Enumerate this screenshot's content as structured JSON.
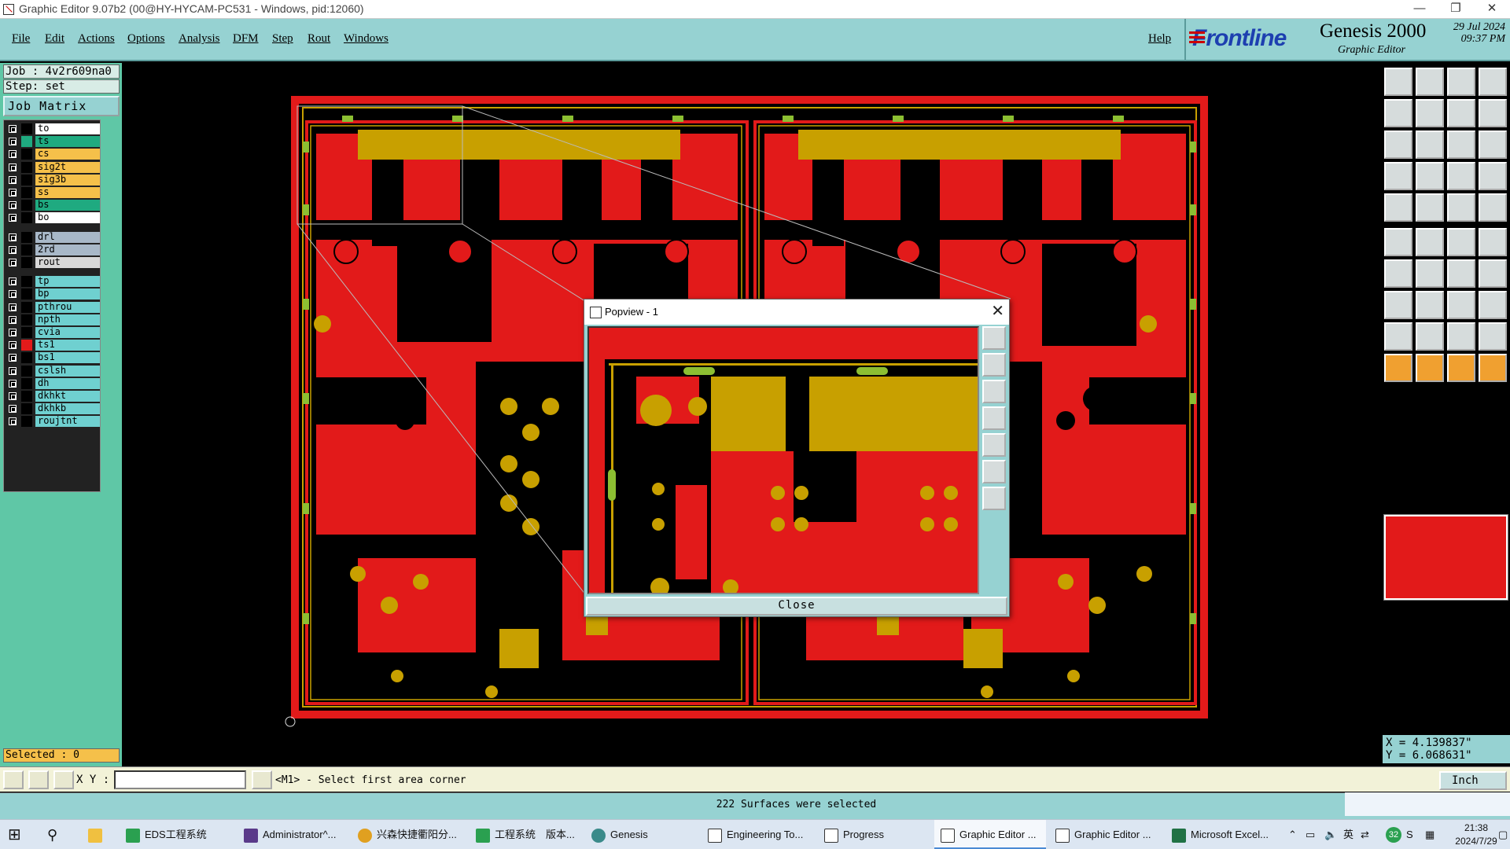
{
  "window": {
    "title": "Graphic Editor 9.07b2 (00@HY-HYCAM-PC531 - Windows, pid:12060)"
  },
  "menu": {
    "items": [
      "File",
      "Edit",
      "Actions",
      "Options",
      "Analysis",
      "DFM",
      "Step",
      "Rout",
      "Windows"
    ],
    "help": "Help"
  },
  "brand": {
    "logo": "Frontline",
    "product": "Genesis 2000",
    "subtitle": "Graphic Editor",
    "date": "29 Jul 2024",
    "time": "09:37 PM"
  },
  "job": {
    "job_label": "Job : 4v2r609na0",
    "step_label": "Step: set",
    "matrix_button": "Job Matrix ..."
  },
  "layers": [
    {
      "name": "to",
      "color": "#ffffff",
      "swatch": "#000000"
    },
    {
      "name": "ts",
      "color": "#1faa80",
      "swatch": "#1faa80"
    },
    {
      "name": "cs",
      "color": "#f5c04a",
      "swatch": "#000000"
    },
    {
      "name": "sig2t",
      "color": "#f5c04a",
      "swatch": "#000000"
    },
    {
      "name": "sig3b",
      "color": "#f5c04a",
      "swatch": "#000000"
    },
    {
      "name": "ss",
      "color": "#f5c04a",
      "swatch": "#000000"
    },
    {
      "name": "bs",
      "color": "#1faa80",
      "swatch": "#000000"
    },
    {
      "name": "bo",
      "color": "#ffffff",
      "swatch": "#000000"
    },
    {
      "name": "drl",
      "color": "#a8b8c8",
      "swatch": "#000000"
    },
    {
      "name": "2rd",
      "color": "#a8b8c8",
      "swatch": "#000000"
    },
    {
      "name": "rout",
      "color": "#d8d8d8",
      "swatch": "#000000"
    },
    {
      "name": "tp",
      "color": "#6fd0d0",
      "swatch": "#000000"
    },
    {
      "name": "bp",
      "color": "#6fd0d0",
      "swatch": "#000000"
    },
    {
      "name": "pthrou",
      "color": "#6fd0d0",
      "swatch": "#000000"
    },
    {
      "name": "npth",
      "color": "#6fd0d0",
      "swatch": "#000000"
    },
    {
      "name": "cvia",
      "color": "#6fd0d0",
      "swatch": "#000000"
    },
    {
      "name": "ts1",
      "color": "#6fd0d0",
      "swatch": "#e21a1a"
    },
    {
      "name": "bs1",
      "color": "#6fd0d0",
      "swatch": "#000000"
    },
    {
      "name": "cslsh",
      "color": "#6fd0d0",
      "swatch": "#000000"
    },
    {
      "name": "dh",
      "color": "#6fd0d0",
      "swatch": "#000000"
    },
    {
      "name": "dkhkt",
      "color": "#6fd0d0",
      "swatch": "#000000"
    },
    {
      "name": "dkhkb",
      "color": "#6fd0d0",
      "swatch": "#000000"
    },
    {
      "name": "roujtnt",
      "color": "#6fd0d0",
      "swatch": "#000000"
    }
  ],
  "selected": "Selected : 0",
  "coords": {
    "x": "X = 4.139837\"",
    "y": "Y = 6.068631\""
  },
  "command": {
    "xy_label": "X Y :",
    "xy_value": "",
    "message": "<M1> - Select first area corner",
    "units": "Inch"
  },
  "status": "222 Surfaces were selected",
  "popview": {
    "title": "Popview - 1",
    "close": "Close"
  },
  "taskbar": {
    "items": [
      "EDS工程系统",
      "Administrator^...",
      "兴森快捷衢阳分...",
      "工程系统　版本...",
      "Genesis",
      "Engineering To...",
      "Progress",
      "Graphic Editor ...",
      "Graphic Editor ...",
      "Microsoft Excel..."
    ],
    "ime_lang": "英",
    "badge": "32",
    "clock_time": "21:38",
    "clock_date": "2024/7/29"
  },
  "colors": {
    "board": "#e21a1a",
    "copper": "#c8a000",
    "pad": "#8cbf32",
    "panel": "#96d2d2",
    "leftpanel": "#5fc7a6"
  }
}
